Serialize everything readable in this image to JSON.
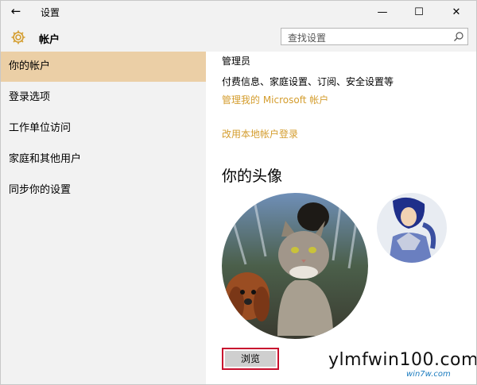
{
  "window": {
    "title": "设置",
    "back_glyph": "←",
    "min_glyph": "—",
    "max_glyph": "☐",
    "close_glyph": "✕"
  },
  "header": {
    "title": "帐户",
    "icon": "gear-icon"
  },
  "search": {
    "placeholder": "查找设置",
    "icon": "search-icon"
  },
  "sidebar": {
    "items": [
      {
        "label": "你的帐户",
        "active": true
      },
      {
        "label": "登录选项",
        "active": false
      },
      {
        "label": "工作单位访问",
        "active": false
      },
      {
        "label": "家庭和其他用户",
        "active": false
      },
      {
        "label": "同步你的设置",
        "active": false
      }
    ]
  },
  "account": {
    "role": "管理员",
    "billing_text": "付费信息、家庭设置、订阅、安全设置等",
    "manage_link": "管理我的 Microsoft 帐户",
    "local_link": "改用本地帐户登录"
  },
  "avatar": {
    "heading": "你的头像",
    "browse_label": "浏览"
  },
  "colors": {
    "accent": "#d49d2e",
    "nav_active": "#ebcfa6",
    "highlight_box": "#c8102e"
  },
  "watermark": {
    "text": "ylmfwin100.com",
    "sub": "win7w.com"
  }
}
